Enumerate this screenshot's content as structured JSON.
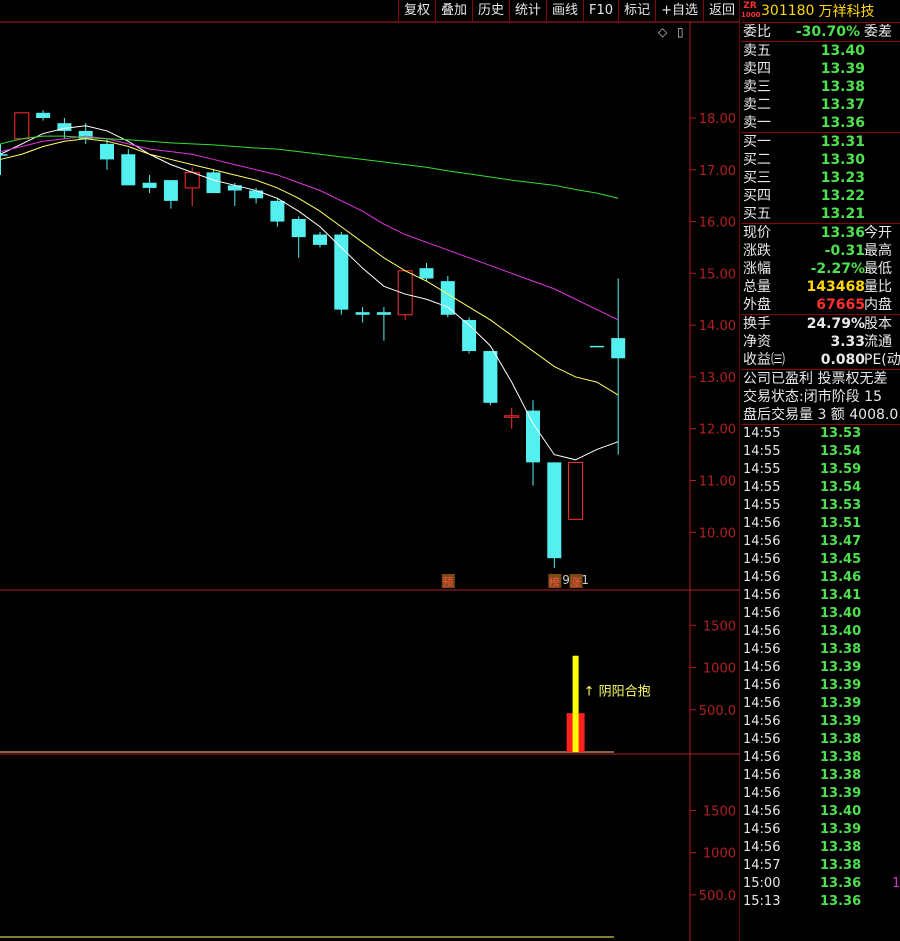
{
  "toolbar": {
    "buttons": [
      "复权",
      "叠加",
      "历史",
      "统计",
      "画线",
      "F10",
      "标记",
      "+自选",
      "返回"
    ],
    "icon_square": "◇",
    "icon_toggle": "▯"
  },
  "stock": {
    "zr_badge": "ZR",
    "zr_sub": "1000",
    "code": "301180",
    "name": "万祥科技"
  },
  "order_book": {
    "weibi_label": "委比",
    "weibi_value": "-30.70%",
    "weicha_label": "委差",
    "asks": [
      {
        "label": "卖五",
        "price": "13.40"
      },
      {
        "label": "卖四",
        "price": "13.39"
      },
      {
        "label": "卖三",
        "price": "13.38"
      },
      {
        "label": "卖二",
        "price": "13.37"
      },
      {
        "label": "卖一",
        "price": "13.36"
      }
    ],
    "bids": [
      {
        "label": "买一",
        "price": "13.31"
      },
      {
        "label": "买二",
        "price": "13.30"
      },
      {
        "label": "买三",
        "price": "13.23"
      },
      {
        "label": "买四",
        "price": "13.22"
      },
      {
        "label": "买五",
        "price": "13.21"
      }
    ]
  },
  "quote": [
    {
      "label": "现价",
      "value": "13.36",
      "color": "#4ee04e",
      "label2": "今开"
    },
    {
      "label": "涨跌",
      "value": "-0.31",
      "color": "#4ee04e",
      "label2": "最高"
    },
    {
      "label": "涨幅",
      "value": "-2.27%",
      "color": "#4ee04e",
      "label2": "最低"
    },
    {
      "label": "总量",
      "value": "143468",
      "color": "#ffd700",
      "label2": "量比"
    },
    {
      "label": "外盘",
      "value": "67665",
      "color": "#ff3030",
      "label2": "内盘"
    }
  ],
  "finance": [
    {
      "label": "换手",
      "value": "24.79%",
      "label2": "股本"
    },
    {
      "label": "净资",
      "value": "3.33",
      "label2": "流通"
    },
    {
      "label": "收益㈢",
      "value": "0.080",
      "label2": "PE(动"
    }
  ],
  "info_lines": [
    "公司已盈利 投票权无差",
    "交易状态:闭市阶段 15",
    "盘后交易量 3 额 4008.0"
  ],
  "ticks": [
    {
      "time": "14:55",
      "price": "13.53"
    },
    {
      "time": "14:55",
      "price": "13.54"
    },
    {
      "time": "14:55",
      "price": "13.59"
    },
    {
      "time": "14:55",
      "price": "13.54"
    },
    {
      "time": "14:55",
      "price": "13.53"
    },
    {
      "time": "14:56",
      "price": "13.51"
    },
    {
      "time": "14:56",
      "price": "13.47"
    },
    {
      "time": "14:56",
      "price": "13.45"
    },
    {
      "time": "14:56",
      "price": "13.46"
    },
    {
      "time": "14:56",
      "price": "13.41"
    },
    {
      "time": "14:56",
      "price": "13.40"
    },
    {
      "time": "14:56",
      "price": "13.40"
    },
    {
      "time": "14:56",
      "price": "13.38"
    },
    {
      "time": "14:56",
      "price": "13.39"
    },
    {
      "time": "14:56",
      "price": "13.39"
    },
    {
      "time": "14:56",
      "price": "13.39"
    },
    {
      "time": "14:56",
      "price": "13.39"
    },
    {
      "time": "14:56",
      "price": "13.38"
    },
    {
      "time": "14:56",
      "price": "13.38"
    },
    {
      "time": "14:56",
      "price": "13.38"
    },
    {
      "time": "14:56",
      "price": "13.39"
    },
    {
      "time": "14:56",
      "price": "13.40"
    },
    {
      "time": "14:56",
      "price": "13.39"
    },
    {
      "time": "14:56",
      "price": "13.38"
    },
    {
      "time": "14:57",
      "price": "13.38"
    },
    {
      "time": "15:00",
      "price": "13.36",
      "extra": "1"
    },
    {
      "time": "15:13",
      "price": "13.36"
    }
  ],
  "chart_data": {
    "type": "candlestick",
    "price_ticks": [
      "18.00",
      "17.00",
      "16.00",
      "15.00",
      "14.00",
      "13.00",
      "12.00",
      "11.00",
      "10.00"
    ],
    "price_range": [
      9.0,
      19.0
    ],
    "candles": [
      {
        "o": 17.3,
        "c": 17.3,
        "h": 17.5,
        "l": 16.9,
        "up": false
      },
      {
        "o": 17.6,
        "c": 18.1,
        "h": 18.1,
        "l": 17.6,
        "up": true
      },
      {
        "o": 18.1,
        "c": 18.0,
        "h": 18.15,
        "l": 17.95,
        "up": false
      },
      {
        "o": 17.9,
        "c": 17.75,
        "h": 18.0,
        "l": 17.6,
        "up": false
      },
      {
        "o": 17.75,
        "c": 17.6,
        "h": 17.9,
        "l": 17.5,
        "up": false
      },
      {
        "o": 17.5,
        "c": 17.2,
        "h": 17.6,
        "l": 17.0,
        "up": false
      },
      {
        "o": 17.3,
        "c": 16.7,
        "h": 17.4,
        "l": 16.7,
        "up": false
      },
      {
        "o": 16.75,
        "c": 16.65,
        "h": 16.9,
        "l": 16.55,
        "up": false
      },
      {
        "o": 16.8,
        "c": 16.4,
        "h": 16.8,
        "l": 16.25,
        "up": false
      },
      {
        "o": 16.65,
        "c": 16.95,
        "h": 17.05,
        "l": 16.3,
        "up": true
      },
      {
        "o": 16.95,
        "c": 16.55,
        "h": 17.0,
        "l": 16.55,
        "up": false
      },
      {
        "o": 16.7,
        "c": 16.6,
        "h": 16.75,
        "l": 16.3,
        "up": false
      },
      {
        "o": 16.6,
        "c": 16.45,
        "h": 16.65,
        "l": 16.35,
        "up": false
      },
      {
        "o": 16.4,
        "c": 16.0,
        "h": 16.45,
        "l": 15.9,
        "up": false
      },
      {
        "o": 16.05,
        "c": 15.7,
        "h": 16.1,
        "l": 15.3,
        "up": false
      },
      {
        "o": 15.75,
        "c": 15.55,
        "h": 15.8,
        "l": 15.5,
        "up": false
      },
      {
        "o": 15.75,
        "c": 14.3,
        "h": 15.8,
        "l": 14.2,
        "up": false
      },
      {
        "o": 14.25,
        "c": 14.2,
        "h": 14.35,
        "l": 14.05,
        "up": false
      },
      {
        "o": 14.25,
        "c": 14.2,
        "h": 14.35,
        "l": 13.7,
        "up": false
      },
      {
        "o": 14.2,
        "c": 15.05,
        "h": 15.05,
        "l": 14.1,
        "up": true
      },
      {
        "o": 15.1,
        "c": 14.9,
        "h": 15.2,
        "l": 14.85,
        "up": false
      },
      {
        "o": 14.85,
        "c": 14.2,
        "h": 14.95,
        "l": 14.15,
        "up": false
      },
      {
        "o": 14.1,
        "c": 13.5,
        "h": 14.15,
        "l": 13.45,
        "up": false
      },
      {
        "o": 13.5,
        "c": 12.5,
        "h": 13.5,
        "l": 12.45,
        "up": false
      },
      {
        "o": 12.25,
        "c": 12.25,
        "h": 12.4,
        "l": 12.0,
        "up": true
      },
      {
        "o": 12.35,
        "c": 11.35,
        "h": 12.55,
        "l": 10.9,
        "up": false
      },
      {
        "o": 11.35,
        "c": 9.5,
        "h": 11.35,
        "l": 9.31,
        "up": false
      },
      {
        "o": 10.25,
        "c": 11.35,
        "h": 11.35,
        "l": 10.25,
        "up": true
      },
      {
        "o": 13.6,
        "c": 13.6,
        "h": 13.6,
        "l": 13.6,
        "up": false
      },
      {
        "o": 13.75,
        "c": 13.36,
        "h": 14.9,
        "l": 11.5,
        "up": false
      }
    ],
    "ma_series": [
      {
        "color": "#ffffff",
        "values": [
          17.3,
          17.5,
          17.7,
          17.8,
          17.85,
          17.75,
          17.55,
          17.3,
          17.1,
          16.95,
          16.8,
          16.7,
          16.6,
          16.45,
          16.2,
          15.9,
          15.5,
          15.1,
          14.75,
          14.6,
          14.5,
          14.35,
          14.0,
          13.6,
          12.9,
          12.1,
          11.5,
          11.4,
          11.6,
          11.75
        ]
      },
      {
        "color": "#ffff66",
        "values": [
          17.2,
          17.3,
          17.45,
          17.55,
          17.6,
          17.55,
          17.45,
          17.3,
          17.2,
          17.1,
          17.0,
          16.9,
          16.8,
          16.65,
          16.45,
          16.2,
          15.9,
          15.6,
          15.3,
          15.05,
          14.85,
          14.6,
          14.35,
          14.1,
          13.8,
          13.5,
          13.2,
          13.0,
          12.9,
          12.65
        ]
      },
      {
        "color": "#e033e0",
        "values": [
          17.35,
          17.45,
          17.55,
          17.6,
          17.65,
          17.6,
          17.5,
          17.4,
          17.35,
          17.3,
          17.2,
          17.1,
          17.0,
          16.9,
          16.75,
          16.6,
          16.4,
          16.2,
          15.95,
          15.75,
          15.6,
          15.45,
          15.3,
          15.15,
          15.0,
          14.85,
          14.7,
          14.5,
          14.3,
          14.1
        ]
      },
      {
        "color": "#33dd33",
        "values": [
          17.5,
          17.6,
          17.65,
          17.65,
          17.62,
          17.6,
          17.58,
          17.55,
          17.52,
          17.5,
          17.48,
          17.45,
          17.42,
          17.4,
          17.35,
          17.3,
          17.25,
          17.2,
          17.15,
          17.1,
          17.05,
          16.98,
          16.92,
          16.86,
          16.8,
          16.75,
          16.7,
          16.62,
          16.55,
          16.45
        ]
      }
    ],
    "low_label": "9.31",
    "markers": [
      {
        "index": 21,
        "text": "预"
      },
      {
        "index": 26,
        "text": "榜"
      },
      {
        "index": 27,
        "text": "涨"
      }
    ],
    "volume_ticks": [
      "1500",
      "1000",
      "500.0"
    ],
    "volume_range": [
      0,
      1800
    ],
    "volume": {
      "index": 27,
      "total": 1140,
      "red_part": 460
    },
    "volume_annotation": "↑ 阴阳合抱",
    "indicator_ticks": [
      "1500",
      "1000",
      "500.0"
    ]
  }
}
